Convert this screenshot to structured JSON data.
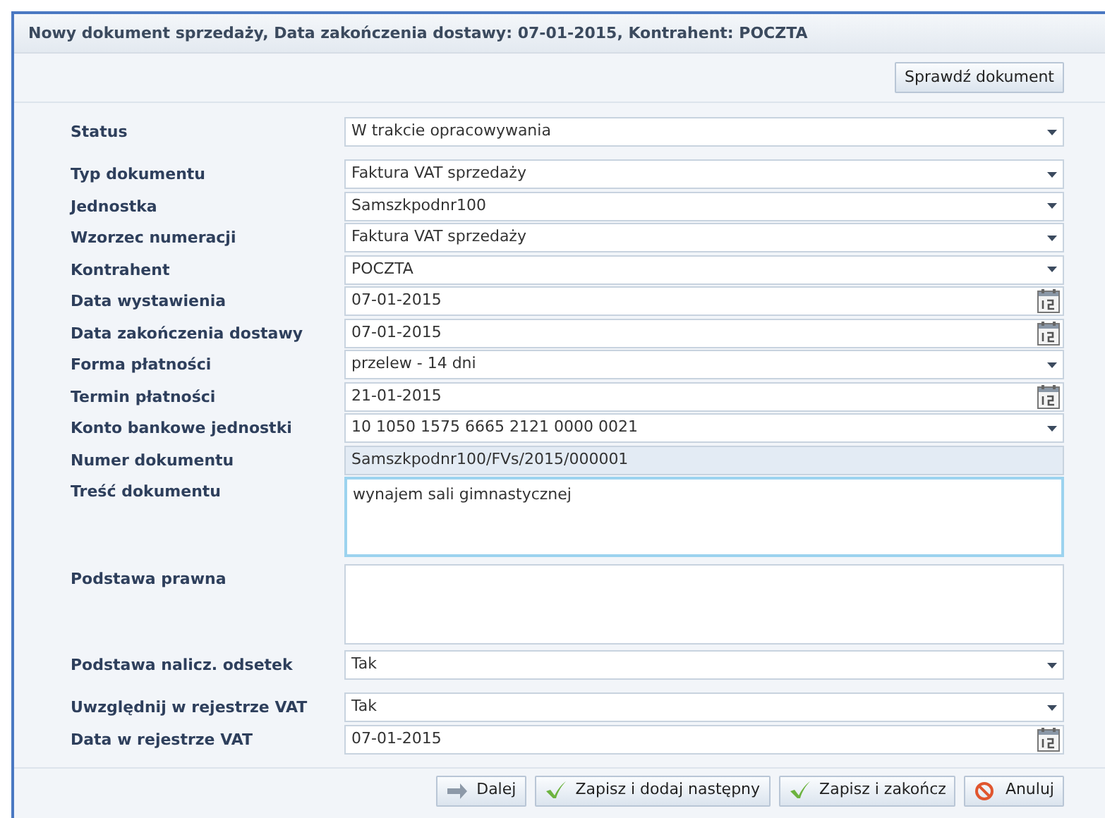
{
  "window": {
    "title": "Nowy dokument sprzedaży, Data zakończenia dostawy: 07-01-2015, Kontrahent: POCZTA"
  },
  "toolbar": {
    "buttons": [
      "Sprawdź dokument"
    ]
  },
  "sections": [
    {
      "fields": [
        {
          "label": "Status",
          "kind": "select",
          "value": "W trakcie opracowywania"
        }
      ]
    },
    {
      "fields": [
        {
          "label": "Typ dokumentu",
          "kind": "select",
          "value": "Faktura VAT sprzedaży"
        },
        {
          "label": "Jednostka",
          "kind": "select",
          "value": "Samszkpodnr100"
        },
        {
          "label": "Wzorzec numeracji",
          "kind": "select",
          "value": "Faktura VAT sprzedaży"
        },
        {
          "label": "Kontrahent",
          "kind": "select",
          "value": "POCZTA"
        },
        {
          "label": "Data wystawienia",
          "kind": "date",
          "value": "07-01-2015"
        },
        {
          "label": "Data zakończenia dostawy",
          "kind": "date",
          "value": "07-01-2015"
        },
        {
          "label": "Forma płatności",
          "kind": "select",
          "value": "przelew - 14 dni"
        },
        {
          "label": "Termin płatności",
          "kind": "date",
          "value": "21-01-2015"
        },
        {
          "label": "Konto bankowe jednostki",
          "kind": "select",
          "value": "10 1050 1575 6665 2121 0000 0021"
        },
        {
          "label": "Numer dokumentu",
          "kind": "readonly",
          "value": "Samszkpodnr100/FVs/2015/000001"
        },
        {
          "label": "Treść dokumentu",
          "kind": "textarea",
          "value": "wynajem sali gimnastycznej",
          "focused": true
        },
        {
          "label": "Podstawa prawna",
          "kind": "textarea",
          "focused": false
        },
        {
          "label": "Podstawa nalicz. odsetek",
          "kind": "select",
          "value": "Tak"
        }
      ]
    },
    {
      "fields": [
        {
          "label": "Uwzględnij w rejestrze VAT",
          "kind": "select",
          "value": "Tak"
        },
        {
          "label": "Data w rejestrze VAT",
          "kind": "date",
          "value": "07-01-2015"
        }
      ]
    }
  ],
  "footer": {
    "buttons": [
      {
        "label": "Dalej",
        "kind": "next"
      },
      {
        "label": "Zapisz i dodaj następny",
        "kind": "save"
      },
      {
        "label": "Zapisz i zakończ",
        "kind": "save"
      },
      {
        "label": "Anuluj",
        "kind": "cancel"
      }
    ]
  }
}
